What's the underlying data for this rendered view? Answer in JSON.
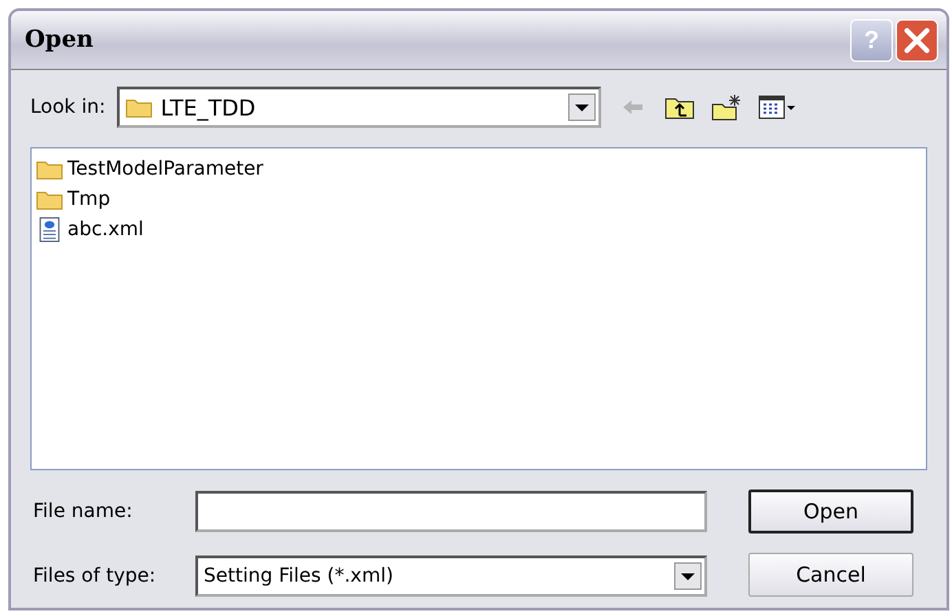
{
  "window": {
    "title": "Open",
    "help_button": "?"
  },
  "look_in": {
    "label": "Look in:",
    "value": "LTE_TDD"
  },
  "files": [
    {
      "name": "TestModelParameter",
      "kind": "folder"
    },
    {
      "name": "Tmp",
      "kind": "folder"
    },
    {
      "name": "abc.xml",
      "kind": "xml"
    }
  ],
  "file_name": {
    "label": "File name:"
  },
  "file_type": {
    "label": "Files of type:",
    "value": "Setting Files (*.xml)"
  },
  "buttons": [
    {
      "label": "Open",
      "default": true
    },
    {
      "label": "Cancel",
      "default": false
    }
  ]
}
